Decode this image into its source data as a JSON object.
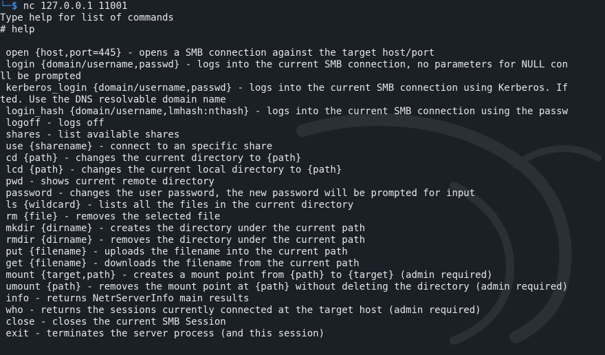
{
  "prompt": {
    "corner": "└─",
    "dollar": "$",
    "command": " nc 127.0.0.1 11001"
  },
  "intro": "Type help for list of commands",
  "help_command": "# help",
  "lines": [
    " open {host,port=445} - opens a SMB connection against the target host/port",
    " login {domain/username,passwd} - logs into the current SMB connection, no parameters for NULL con",
    "ll be prompted",
    " kerberos_login {domain/username,passwd} - logs into the current SMB connection using Kerberos. If",
    "ted. Use the DNS resolvable domain name",
    " login_hash {domain/username,lmhash:nthash} - logs into the current SMB connection using the passw",
    " logoff - logs off",
    " shares - list available shares",
    " use {sharename} - connect to an specific share",
    " cd {path} - changes the current directory to {path}",
    " lcd {path} - changes the current local directory to {path}",
    " pwd - shows current remote directory",
    " password - changes the user password, the new password will be prompted for input",
    " ls {wildcard} - lists all the files in the current directory",
    " rm {file} - removes the selected file",
    " mkdir {dirname} - creates the directory under the current path",
    " rmdir {dirname} - removes the directory under the current path",
    " put {filename} - uploads the filename into the current path",
    " get {filename} - downloads the filename from the current path",
    " mount {target,path} - creates a mount point from {path} to {target} (admin required)",
    " umount {path} - removes the mount point at {path} without deleting the directory (admin required)",
    " info - returns NetrServerInfo main results",
    " who - returns the sessions currently connected at the target host (admin required)",
    " close - closes the current SMB Session",
    " exit - terminates the server process (and this session)"
  ]
}
